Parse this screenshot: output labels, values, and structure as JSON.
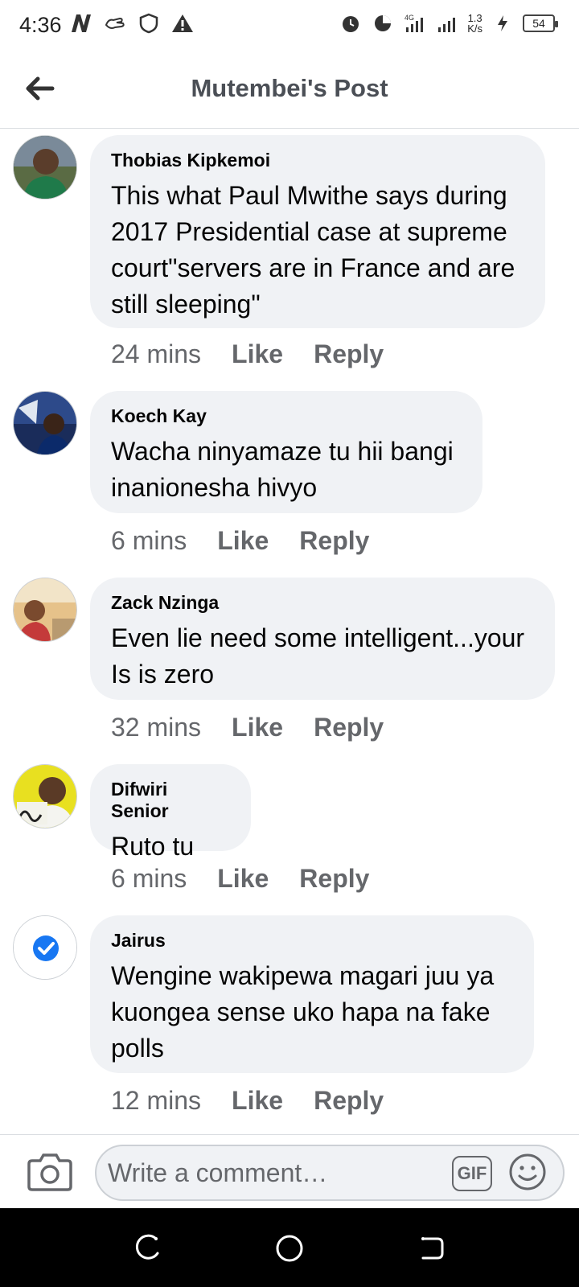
{
  "status_bar": {
    "time": "4:36",
    "network_speed_value": "1.3",
    "network_speed_unit": "K/s",
    "battery": "54",
    "network_type": "4G",
    "left_icons": [
      "n-logo-icon",
      "hand-icon",
      "shield-icon",
      "warning-icon"
    ],
    "right_icons": [
      "alarm-icon",
      "data-saver-icon",
      "signal-icon",
      "signal-icon",
      "charging-icon",
      "battery-icon"
    ]
  },
  "header": {
    "title": "Mutembei's Post",
    "back_icon": "back-arrow-icon"
  },
  "comments": [
    {
      "author": "Thobias Kipkemoi",
      "text": "This what Paul Mwithe says during 2017 Presidential case at supreme court\"servers are in France and are still sleeping\"",
      "time": "24 mins",
      "like_label": "Like",
      "reply_label": "Reply"
    },
    {
      "author": "Koech Kay",
      "text": "Wacha ninyamaze tu hii bangi inanionesha hivyo",
      "time": "6 mins",
      "like_label": "Like",
      "reply_label": "Reply"
    },
    {
      "author": "Zack Nzinga",
      "text": "Even lie need some intelligent...your Is is zero",
      "time": "32 mins",
      "like_label": "Like",
      "reply_label": "Reply"
    },
    {
      "author": "Difwiri Senior",
      "text": "Ruto tu",
      "time": "6 mins",
      "like_label": "Like",
      "reply_label": "Reply"
    },
    {
      "author": "Jairus",
      "text": "Wengine wakipewa magari juu ya kuongea sense uko hapa na fake polls",
      "time": "12 mins",
      "like_label": "Like",
      "reply_label": "Reply"
    }
  ],
  "composer": {
    "placeholder": "Write a comment…",
    "gif_label": "GIF",
    "camera_icon": "camera-icon",
    "emoji_icon": "emoji-icon"
  },
  "nav_bar": {
    "icons": [
      "recent-apps-icon",
      "home-icon",
      "back-icon"
    ]
  },
  "colors": {
    "bubble": "#f0f2f5",
    "secondary_text": "#65676b",
    "header_title": "#4b4f56",
    "verified_blue": "#1877f2"
  }
}
